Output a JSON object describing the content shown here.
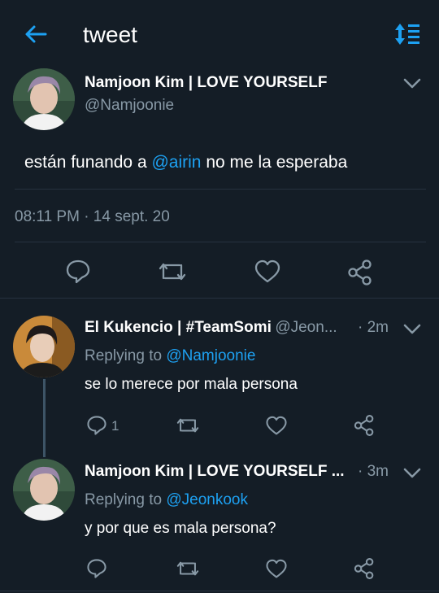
{
  "header": {
    "title": "tweet",
    "back_icon": "arrow-left-icon",
    "sort_icon": "sort-icon"
  },
  "colors": {
    "background": "#141d26",
    "accent": "#1da1f2",
    "muted": "#8899a6",
    "divider": "#26323f"
  },
  "main_tweet": {
    "author_name": "Namjoon Kim | LOVE YOURSELF",
    "handle": "@Namjoonie",
    "text_before": "están funando a ",
    "mention": "@airin",
    "text_after": " no me la esperaba",
    "timestamp": "08:11 PM · 14 sept. 20"
  },
  "replies": [
    {
      "author_name": "El Kukencio | #TeamSomi",
      "handle": "@Jeon...",
      "time": "· 2m",
      "replying_prefix": "Replying to ",
      "replying_to": "@Namjoonie",
      "text": "se lo merece por mala persona",
      "reply_count": "1"
    },
    {
      "author_name": "Namjoon Kim | LOVE YOURSELF ...",
      "handle": "",
      "time": "· 3m",
      "replying_prefix": "Replying to ",
      "replying_to": "@Jeonkook",
      "text": "y por que es mala persona?",
      "reply_count": ""
    }
  ]
}
